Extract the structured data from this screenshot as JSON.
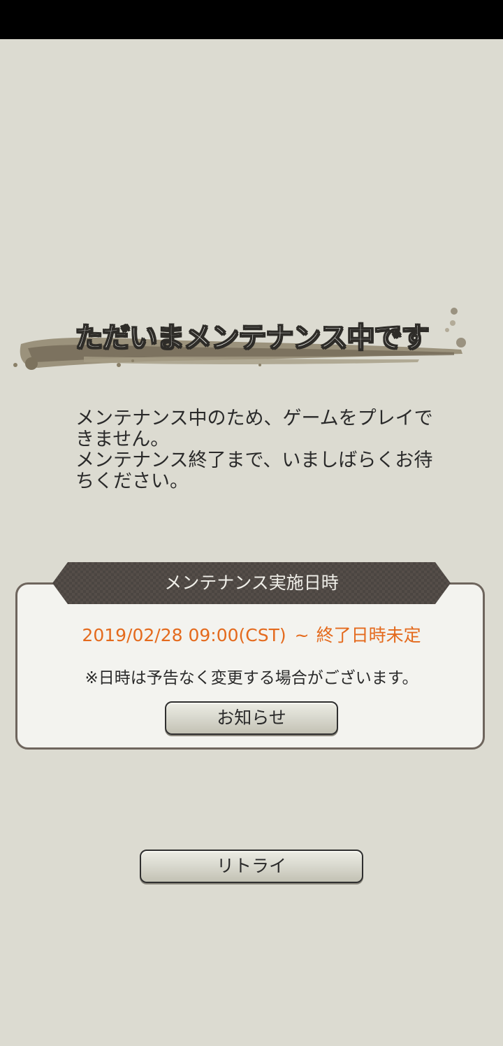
{
  "screen": {
    "title": "ただいまメンテナンス中です",
    "message_lines": [
      "メンテナンス中のため、ゲームをプレイで",
      "きません。",
      "メンテナンス終了まで、いましばらくお待",
      "ちください。"
    ]
  },
  "info_panel": {
    "heading": "メンテナンス実施日時",
    "start": "2019/02/28 09:00(CST)",
    "separator": "~",
    "end": "終了日時未定",
    "note": "※日時は予告なく変更する場合がございます。",
    "notice_button_label": "お知らせ"
  },
  "retry_button_label": "リトライ",
  "colors": {
    "background": "#dcdbd1",
    "schedule_text": "#e46a1d",
    "banner": "#4a4440"
  }
}
